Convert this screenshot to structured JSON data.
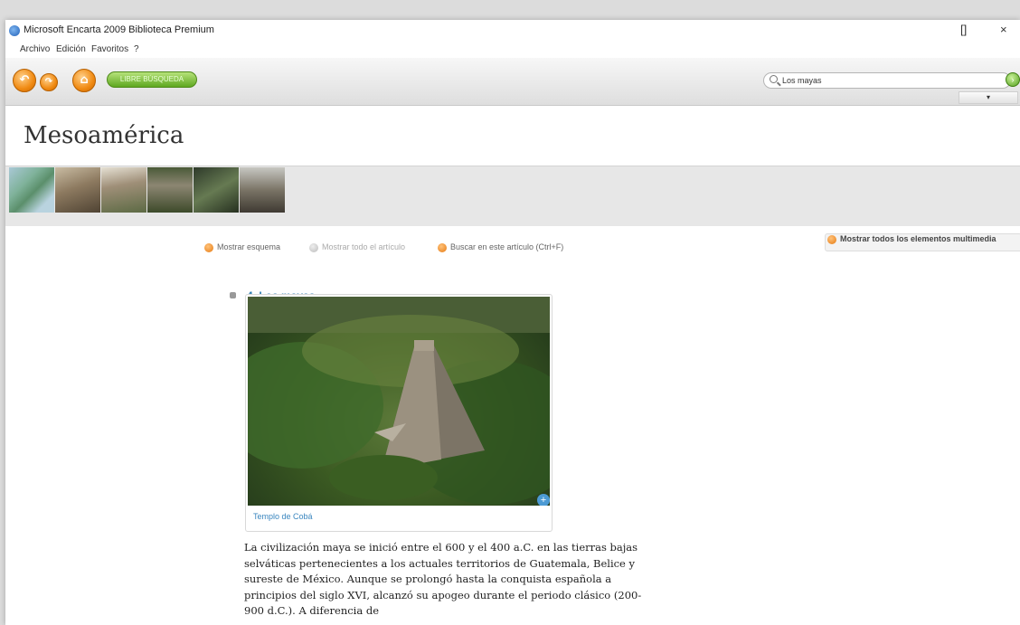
{
  "window": {
    "title": "Microsoft Encarta 2009 Biblioteca Premium",
    "restore_label": "[]",
    "close_label": "×"
  },
  "menu": {
    "items": [
      "Archivo",
      "Edición",
      "Favoritos",
      "?"
    ]
  },
  "toolbar": {
    "back_label": "↶",
    "forward_label": "↷",
    "home_label": "⌂",
    "green_button_label": "LIBRE BÚSQUEDA",
    "search_value": "Los mayas",
    "search_go_label": "›",
    "dropdown_label": "▾"
  },
  "article": {
    "title": "Mesoamérica",
    "actions": {
      "show_outline": "Mostrar esquema",
      "show_whole_article": "Mostrar todo el artículo",
      "search_in_article": "Buscar en este artículo (Ctrl+F)",
      "show_all_multimedia": "Mostrar todos los elementos multimedia"
    },
    "section": {
      "title": "4. Los mayas",
      "caption": "Templo de Cobá",
      "zoom_label": "+",
      "body": "La civilización maya se inició entre el 600 y el 400 a.C. en las tierras bajas selváticas pertenecientes a los actuales territorios de Guatemala, Belice y sureste de México. Aunque se prolongó hasta la conquista española a principios del siglo XVI, alcanzó su apogeo durante el periodo clásico (200-900 d.C.). A diferencia de"
    }
  },
  "colors": {
    "accent_orange": "#f08a12",
    "link_blue": "#2f7db2",
    "green_button": "#5fa821"
  }
}
